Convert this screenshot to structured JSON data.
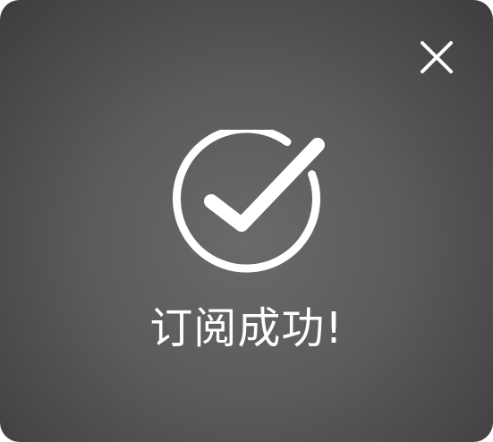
{
  "dialog": {
    "message": "订阅成功!",
    "close_icon": "close-icon",
    "status_icon": "check-circle-icon"
  },
  "colors": {
    "background_center": "#6a6a6a",
    "background_edge": "#3d3d3d",
    "foreground": "#ffffff"
  }
}
